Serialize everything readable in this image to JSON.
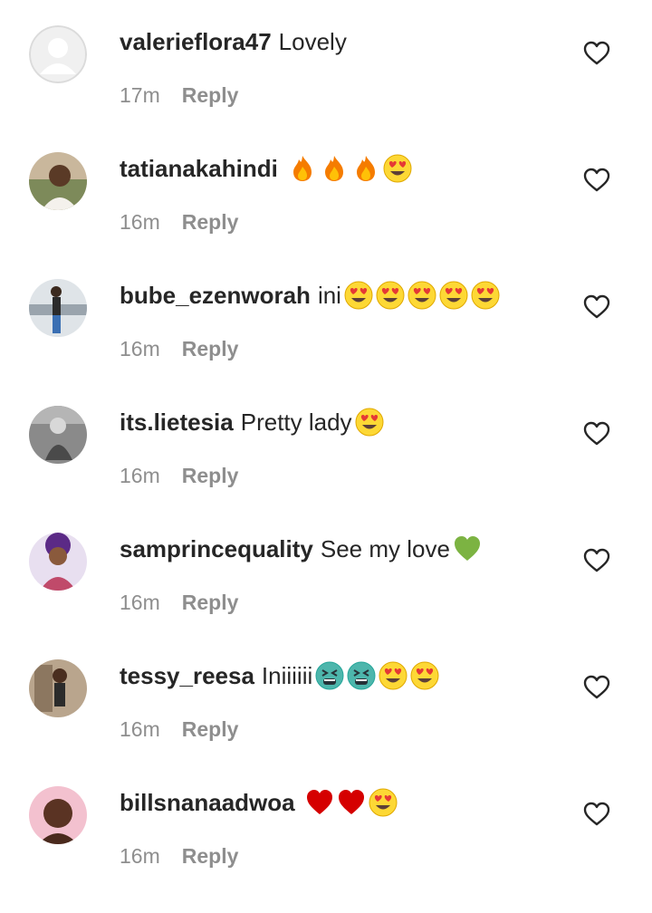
{
  "comments": [
    {
      "username": "valerieflora47",
      "text": "Lovely",
      "emojis": [],
      "time": "17m",
      "reply": "Reply",
      "avatar": "default"
    },
    {
      "username": "tatianakahindi",
      "text": "",
      "emojis": [
        "fire",
        "fire",
        "fire",
        "heart-eyes"
      ],
      "time": "16m",
      "reply": "Reply",
      "avatar": "photo"
    },
    {
      "username": "bube_ezenworah",
      "text": "ini",
      "emojis": [
        "heart-eyes",
        "heart-eyes",
        "heart-eyes",
        "heart-eyes",
        "heart-eyes"
      ],
      "time": "16m",
      "reply": "Reply",
      "avatar": "photo"
    },
    {
      "username": "its.lietesia",
      "text": "Pretty lady",
      "emojis": [
        "heart-eyes"
      ],
      "time": "16m",
      "reply": "Reply",
      "avatar": "photo"
    },
    {
      "username": "samprincequality",
      "text": "See my love",
      "emojis": [
        "green-heart"
      ],
      "time": "16m",
      "reply": "Reply",
      "avatar": "photo"
    },
    {
      "username": "tessy_reesa",
      "text": "Iniiiiii",
      "emojis": [
        "tired-face",
        "tired-face",
        "heart-eyes",
        "heart-eyes"
      ],
      "time": "16m",
      "reply": "Reply",
      "avatar": "photo"
    },
    {
      "username": "billsnanaadwoa",
      "text": "",
      "emojis": [
        "red-heart",
        "red-heart",
        "heart-eyes"
      ],
      "time": "16m",
      "reply": "Reply",
      "avatar": "photo"
    }
  ],
  "colors": {
    "username": "#262626",
    "meta": "#8e8e8e",
    "like_outline": "#262626"
  },
  "icons": {
    "like": "heart-outline-icon"
  }
}
